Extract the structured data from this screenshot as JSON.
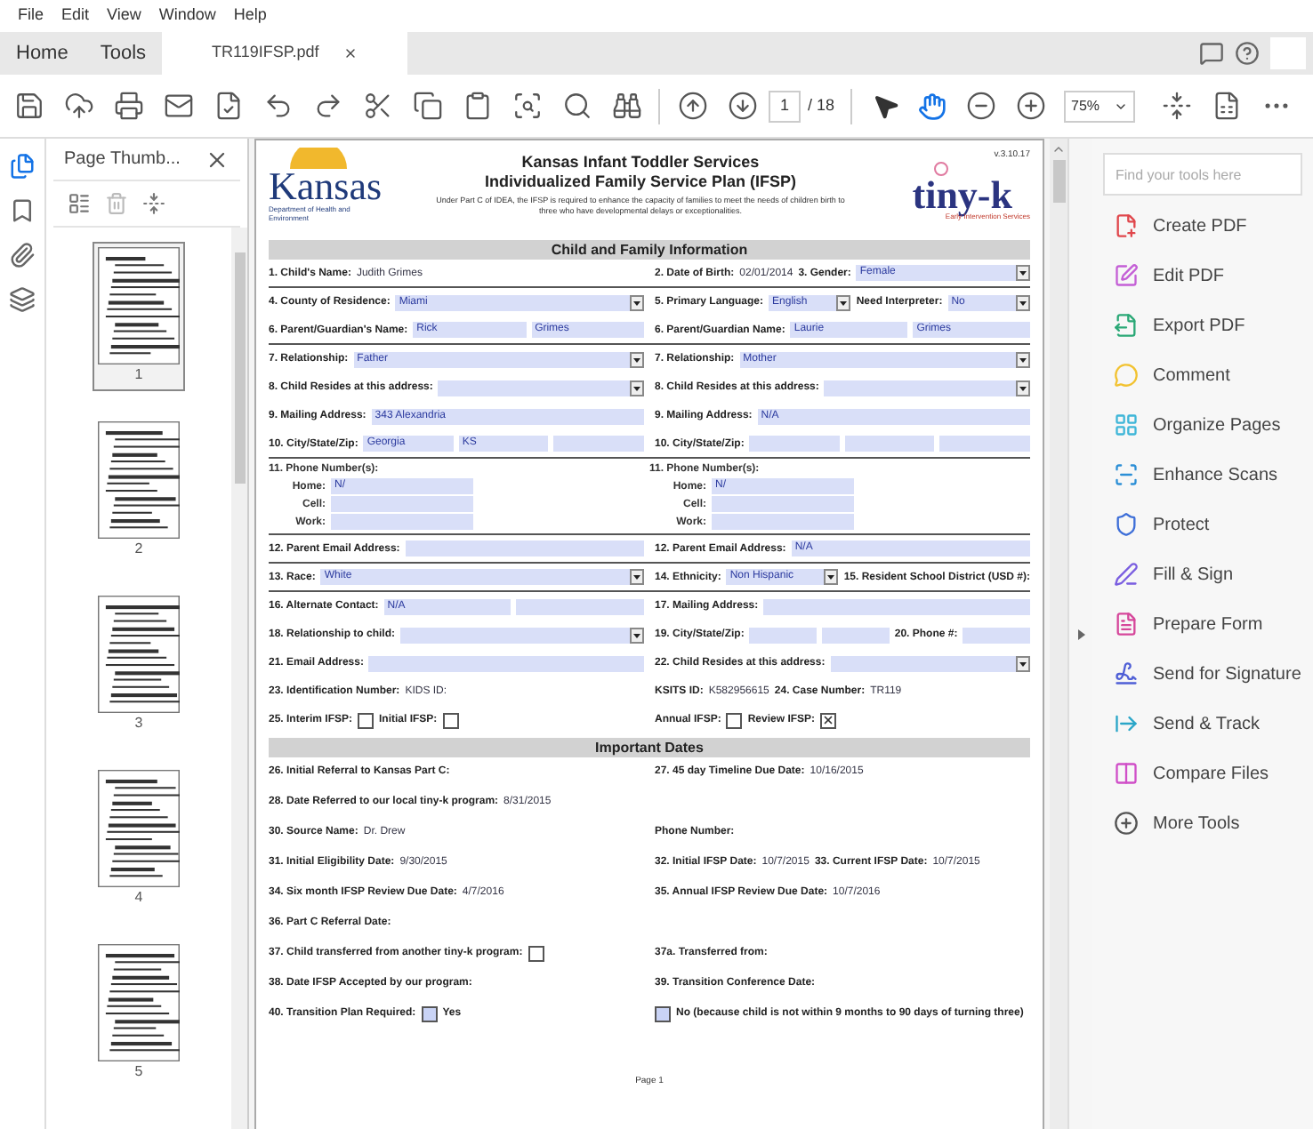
{
  "menu": [
    "File",
    "Edit",
    "View",
    "Window",
    "Help"
  ],
  "tabs": [
    {
      "label": "Home",
      "selected": false
    },
    {
      "label": "Tools",
      "selected": false
    },
    {
      "label": "TR119IFSP.pdf",
      "selected": true
    }
  ],
  "toolbar": {
    "page": "1",
    "total": "/ 18",
    "zoom": "75%",
    "select_tools": [
      {
        "kind": "pointer",
        "selected": false
      },
      {
        "kind": "hand",
        "selected": true
      }
    ]
  },
  "left_rail": [
    {
      "kind": "pages",
      "selected": true
    },
    {
      "kind": "bookmarks",
      "selected": false
    },
    {
      "kind": "attachments",
      "selected": false
    },
    {
      "kind": "layers",
      "selected": false
    }
  ],
  "thumbnails": {
    "title": "Page Thumb...",
    "pages": [
      {
        "label": "1",
        "selected": true
      },
      {
        "label": "2",
        "selected": false
      },
      {
        "label": "3",
        "selected": false
      },
      {
        "label": "4",
        "selected": false
      },
      {
        "label": "5",
        "selected": false
      }
    ]
  },
  "document": {
    "version": "v.3.10.17",
    "logo": "Kansas",
    "logo_sub": "Department of Health and Environment",
    "title": "Kansas Infant Toddler Services",
    "subtitle": "Individualized Family Service Plan (IFSP)",
    "intro": "Under Part C of IDEA, the IFSP is required to enhance the capacity of families to meet the needs of children birth to three who have developmental delays or exceptionalities.",
    "brand": "tiny-k",
    "brand_sub": "Early Intervention Services",
    "sections": [
      {
        "title": "Child and Family Information",
        "rows": [
          {
            "kind": "line",
            "rule": true,
            "groups": [
              [
                {
                  "kind": "label",
                  "text": "1. Child's Name:"
                },
                {
                  "kind": "value",
                  "text": "Judith  Grimes"
                }
              ],
              [
                {
                  "kind": "label",
                  "text": "2. Date of Birth:"
                },
                {
                  "kind": "value",
                  "text": "02/01/2014"
                },
                {
                  "kind": "label",
                  "text": "3. Gender:"
                },
                {
                  "kind": "dropdown",
                  "value": "Female"
                }
              ]
            ]
          },
          {
            "kind": "line",
            "rule": false,
            "groups": [
              [
                {
                  "kind": "label",
                  "text": "4. County of Residence:"
                },
                {
                  "kind": "dropdown",
                  "value": "Miami"
                }
              ],
              [
                {
                  "kind": "label",
                  "text": "5. Primary Language:"
                },
                {
                  "kind": "dropdown",
                  "value": "English"
                },
                {
                  "kind": "label",
                  "text": "Need Interpreter:"
                },
                {
                  "kind": "dropdown",
                  "value": "No"
                }
              ]
            ]
          },
          {
            "kind": "line",
            "rule": true,
            "groups": [
              [
                {
                  "kind": "label",
                  "text": "6. Parent/Guardian's Name:"
                },
                {
                  "kind": "field",
                  "value": "Rick"
                },
                {
                  "kind": "field",
                  "value": "Grimes"
                }
              ],
              [
                {
                  "kind": "label",
                  "text": "6. Parent/Guardian Name:"
                },
                {
                  "kind": "field",
                  "value": "Laurie"
                },
                {
                  "kind": "field",
                  "value": "Grimes"
                }
              ]
            ]
          },
          {
            "kind": "line",
            "rule": false,
            "groups": [
              [
                {
                  "kind": "label",
                  "text": "7. Relationship:"
                },
                {
                  "kind": "dropdown",
                  "value": "Father"
                }
              ],
              [
                {
                  "kind": "label",
                  "text": "7. Relationship:"
                },
                {
                  "kind": "dropdown",
                  "value": "Mother"
                }
              ]
            ]
          },
          {
            "kind": "line",
            "rule": false,
            "groups": [
              [
                {
                  "kind": "label",
                  "text": "8. Child Resides at this address:"
                },
                {
                  "kind": "dropdown"
                }
              ],
              [
                {
                  "kind": "label",
                  "text": "8. Child Resides at this address:"
                },
                {
                  "kind": "dropdown"
                }
              ]
            ]
          },
          {
            "kind": "line",
            "rule": false,
            "groups": [
              [
                {
                  "kind": "label",
                  "text": "9. Mailing Address:"
                },
                {
                  "kind": "field",
                  "value": "343 Alexandria"
                }
              ],
              [
                {
                  "kind": "label",
                  "text": "9. Mailing Address:"
                },
                {
                  "kind": "field",
                  "value": "N/A"
                }
              ]
            ]
          },
          {
            "kind": "line",
            "rule": true,
            "groups": [
              [
                {
                  "kind": "label",
                  "text": "10.  City/State/Zip:"
                },
                {
                  "kind": "field",
                  "value": "Georgia"
                },
                {
                  "kind": "field",
                  "value": "KS"
                },
                {
                  "kind": "field"
                }
              ],
              [
                {
                  "kind": "label",
                  "text": "10. City/State/Zip:"
                },
                {
                  "kind": "field"
                },
                {
                  "kind": "field"
                },
                {
                  "kind": "field"
                }
              ]
            ]
          },
          {
            "kind": "phone",
            "columns": [
              {
                "title": "11.  Phone Number(s):",
                "lines": [
                  {
                    "label": "Home:",
                    "value": "N/"
                  },
                  {
                    "label": "Cell:"
                  },
                  {
                    "label": "Work:"
                  }
                ]
              },
              {
                "title": "11. Phone Number(s):",
                "lines": [
                  {
                    "label": "Home:",
                    "value": "N/"
                  },
                  {
                    "label": "Cell:"
                  },
                  {
                    "label": "Work:"
                  }
                ]
              }
            ]
          },
          {
            "kind": "line",
            "rule": true,
            "groups": [
              [
                {
                  "kind": "label",
                  "text": "12.  Parent Email Address:"
                },
                {
                  "kind": "field"
                }
              ],
              [
                {
                  "kind": "label",
                  "text": "12. Parent Email Address:"
                },
                {
                  "kind": "field",
                  "value": "N/A"
                }
              ]
            ]
          },
          {
            "kind": "line",
            "rule": true,
            "groups": [
              [
                {
                  "kind": "label",
                  "text": "13.  Race:"
                },
                {
                  "kind": "dropdown",
                  "value": "White"
                }
              ],
              [
                {
                  "kind": "label",
                  "text": "14. Ethnicity:"
                },
                {
                  "kind": "dropdown",
                  "value": "Non Hispanic"
                },
                {
                  "kind": "label",
                  "text": "15. Resident School District (USD #):"
                }
              ]
            ]
          },
          {
            "kind": "line",
            "rule": false,
            "groups": [
              [
                {
                  "kind": "label",
                  "text": "16. Alternate Contact:"
                },
                {
                  "kind": "field",
                  "value": "N/A"
                },
                {
                  "kind": "field"
                }
              ],
              [
                {
                  "kind": "label",
                  "text": "17. Mailing Address:"
                },
                {
                  "kind": "field"
                }
              ]
            ]
          },
          {
            "kind": "line",
            "rule": false,
            "groups": [
              [
                {
                  "kind": "label",
                  "text": "18. Relationship to child:"
                },
                {
                  "kind": "dropdown"
                }
              ],
              [
                {
                  "kind": "label",
                  "text": "19. City/State/Zip:"
                },
                {
                  "kind": "field"
                },
                {
                  "kind": "field"
                },
                {
                  "kind": "label",
                  "text": "20. Phone #:"
                },
                {
                  "kind": "field"
                }
              ]
            ]
          },
          {
            "kind": "line",
            "rule": false,
            "groups": [
              [
                {
                  "kind": "label",
                  "text": "21. Email Address:"
                },
                {
                  "kind": "field"
                }
              ],
              [
                {
                  "kind": "label",
                  "text": "22. Child Resides at this address:"
                },
                {
                  "kind": "dropdown"
                }
              ]
            ]
          },
          {
            "kind": "line",
            "rule": false,
            "groups": [
              [
                {
                  "kind": "label",
                  "text": "23. Identification Number:"
                },
                {
                  "kind": "value",
                  "text": "KIDS ID:"
                }
              ],
              [
                {
                  "kind": "label",
                  "text": "KSITS ID:"
                },
                {
                  "kind": "value",
                  "text": "K582956615"
                },
                {
                  "kind": "label",
                  "text": "24. Case Number:"
                },
                {
                  "kind": "value",
                  "text": "TR119"
                }
              ]
            ]
          },
          {
            "kind": "line",
            "rule": false,
            "groups": [
              [
                {
                  "kind": "label",
                  "text": "25. Interim IFSP:"
                },
                {
                  "kind": "checkbox",
                  "checked": false
                },
                {
                  "kind": "label",
                  "text": "Initial IFSP:"
                },
                {
                  "kind": "checkbox",
                  "checked": false
                }
              ],
              [
                {
                  "kind": "label",
                  "text": "Annual IFSP:"
                },
                {
                  "kind": "checkbox",
                  "checked": false
                },
                {
                  "kind": "label",
                  "text": "Review IFSP:"
                },
                {
                  "kind": "checkbox",
                  "checked": true
                }
              ]
            ]
          }
        ]
      },
      {
        "title": "Important Dates",
        "rows": [
          {
            "kind": "line",
            "rule": false,
            "groups": [
              [
                {
                  "kind": "label",
                  "text": "26. Initial Referral to Kansas Part C:"
                }
              ],
              [
                {
                  "kind": "label",
                  "text": "27. 45 day Timeline Due Date:"
                },
                {
                  "kind": "value",
                  "text": "10/16/2015"
                }
              ]
            ]
          },
          {
            "kind": "line",
            "rule": false,
            "groups": [
              [
                {
                  "kind": "label",
                  "text": "28. Date Referred to our local tiny-k program:"
                },
                {
                  "kind": "value",
                  "text": "8/31/2015"
                }
              ]
            ]
          },
          {
            "kind": "line",
            "rule": false,
            "groups": [
              [
                {
                  "kind": "label",
                  "text": "30. Source Name:"
                },
                {
                  "kind": "value",
                  "text": "Dr. Drew"
                }
              ],
              [
                {
                  "kind": "label",
                  "text": "Phone Number:"
                }
              ]
            ]
          },
          {
            "kind": "line",
            "rule": false,
            "groups": [
              [
                {
                  "kind": "label",
                  "text": "31. Initial Eligibility Date:"
                },
                {
                  "kind": "value",
                  "text": "9/30/2015"
                }
              ],
              [
                {
                  "kind": "label",
                  "text": "32. Initial IFSP Date:"
                },
                {
                  "kind": "value",
                  "text": "10/7/2015"
                },
                {
                  "kind": "label",
                  "text": "33. Current IFSP Date:"
                },
                {
                  "kind": "value",
                  "text": "10/7/2015"
                }
              ]
            ]
          },
          {
            "kind": "line",
            "rule": false,
            "groups": [
              [
                {
                  "kind": "label",
                  "text": "34. Six month IFSP Review Due Date:"
                },
                {
                  "kind": "value",
                  "text": "4/7/2016"
                }
              ],
              [
                {
                  "kind": "label",
                  "text": "35. Annual IFSP Review Due Date:"
                },
                {
                  "kind": "value",
                  "text": "10/7/2016"
                }
              ]
            ]
          },
          {
            "kind": "line",
            "rule": false,
            "groups": [
              [
                {
                  "kind": "label",
                  "text": "36. Part C Referral Date:"
                }
              ]
            ]
          },
          {
            "kind": "line",
            "rule": false,
            "groups": [
              [
                {
                  "kind": "label",
                  "text": "37. Child transferred from another tiny-k program:"
                },
                {
                  "kind": "checkbox",
                  "checked": false
                }
              ],
              [
                {
                  "kind": "label",
                  "text": "37a. Transferred from:"
                }
              ]
            ]
          },
          {
            "kind": "line",
            "rule": false,
            "groups": [
              [
                {
                  "kind": "label",
                  "text": "38. Date IFSP Accepted by our program:"
                }
              ],
              [
                {
                  "kind": "label",
                  "text": "39. Transition Conference Date:"
                }
              ]
            ]
          },
          {
            "kind": "line",
            "rule": false,
            "groups": [
              [
                {
                  "kind": "label",
                  "text": "40. Transition Plan Required:"
                },
                {
                  "kind": "option",
                  "checked": false
                },
                {
                  "kind": "label",
                  "text": "Yes"
                }
              ],
              [
                {
                  "kind": "option",
                  "checked": false
                },
                {
                  "kind": "label",
                  "text": "No (because child is not within 9 months to 90 days of turning three)"
                }
              ]
            ]
          }
        ]
      }
    ],
    "footer": "Page 1"
  },
  "tools_panel": {
    "search": {
      "placeholder": "Find your tools here"
    },
    "items": [
      {
        "label": "Create PDF",
        "color": "#e0474c"
      },
      {
        "label": "Edit PDF",
        "color": "#c45fd6"
      },
      {
        "label": "Export PDF",
        "color": "#2aa876"
      },
      {
        "label": "Comment",
        "color": "#f2c230"
      },
      {
        "label": "Organize Pages",
        "color": "#3fb6d8"
      },
      {
        "label": "Enhance Scans",
        "color": "#2c8fd6"
      },
      {
        "label": "Protect",
        "color": "#3d6ed8"
      },
      {
        "label": "Fill & Sign",
        "color": "#7a5ee0"
      },
      {
        "label": "Prepare Form",
        "color": "#d6479b"
      },
      {
        "label": "Send for Signature",
        "color": "#4f5fd6"
      },
      {
        "label": "Send & Track",
        "color": "#2aa6c8"
      },
      {
        "label": "Compare Files",
        "color": "#d04fc8"
      },
      {
        "label": "More Tools",
        "color": "#555555"
      }
    ]
  }
}
